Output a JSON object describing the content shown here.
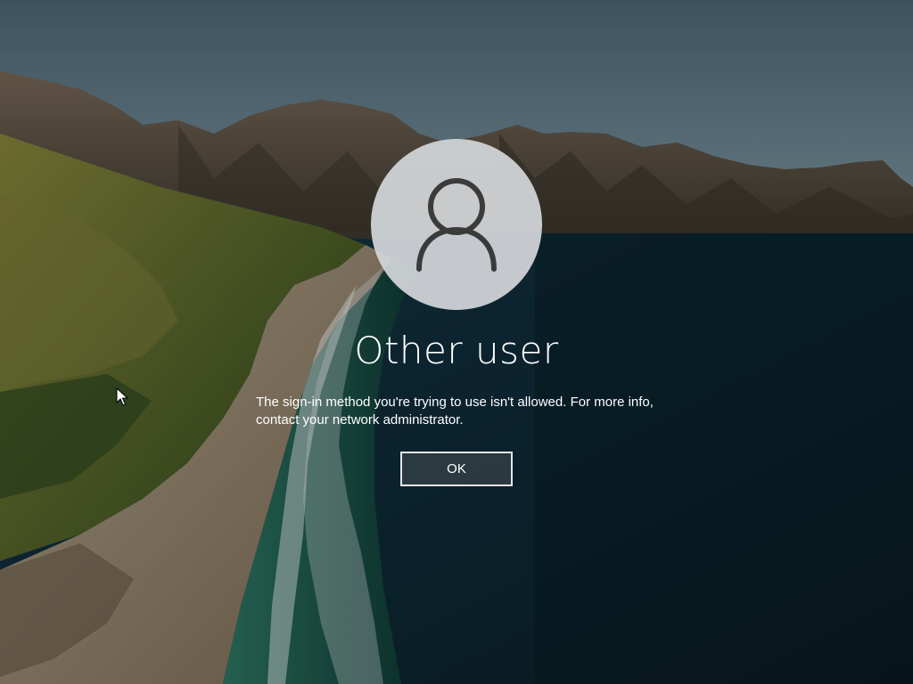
{
  "colors": {
    "sky": "#5f7b8a",
    "sea_deep": "#0f2a36",
    "sea_green": "#1f5a48",
    "sand": "#a79a83",
    "mountain": "#5b5044",
    "hills": "#6f7a34",
    "avatar_bg": "#d3d6d9",
    "avatar_glyph": "#3c3c3c",
    "text": "#ffffff",
    "button_border": "#e6e6e6"
  },
  "icons": {
    "avatar": "user-silhouette-icon",
    "cursor": "mouse-pointer-icon"
  },
  "signin": {
    "user_name": "Other user",
    "message_line1": "The sign-in method you're trying to use isn't allowed. For more info,",
    "message_line2": "contact your network administrator.",
    "ok_label": "OK"
  }
}
